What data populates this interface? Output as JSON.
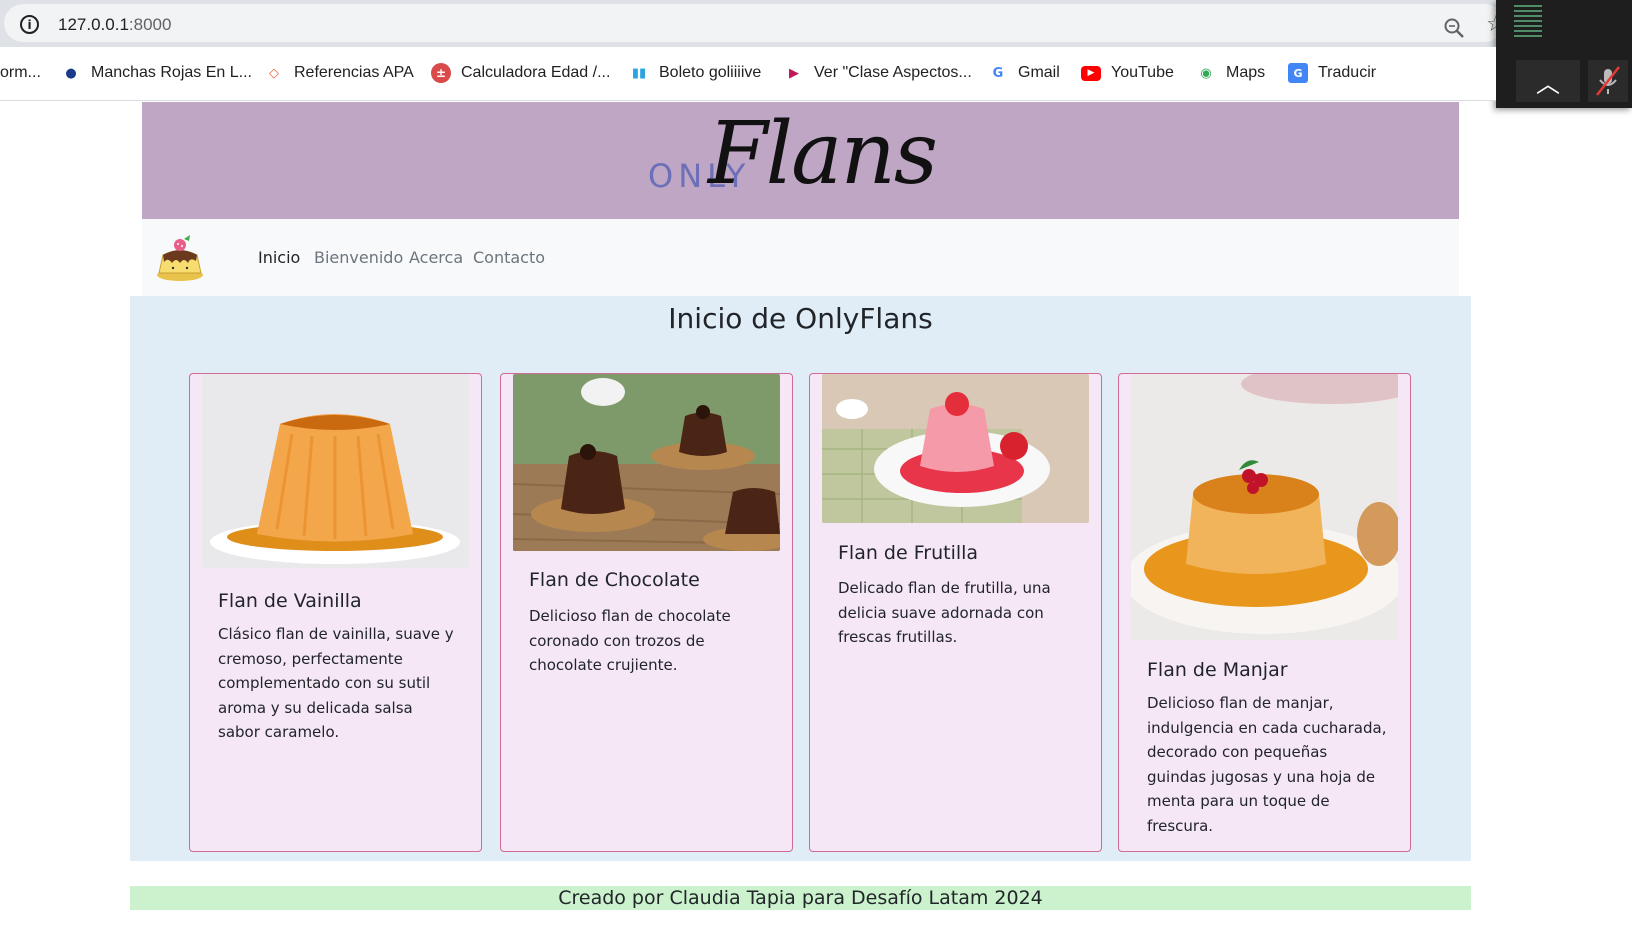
{
  "browser": {
    "url_host": "127.0.0.1",
    "url_port": ":8000",
    "bookmarks": [
      {
        "label": "orm...",
        "icon": "doc-icon"
      },
      {
        "label": "Manchas Rojas En L...",
        "icon": "apple-icon"
      },
      {
        "label": "Referencias APA",
        "icon": "grad-cap-icon"
      },
      {
        "label": "Calculadora Edad /...",
        "icon": "calc-icon"
      },
      {
        "label": "Boleto goliiiive",
        "icon": "bars-icon"
      },
      {
        "label": "Ver \"Clase Aspectos...",
        "icon": "play-icon"
      },
      {
        "label": "Gmail",
        "icon": "google-icon"
      },
      {
        "label": "YouTube",
        "icon": "youtube-icon"
      },
      {
        "label": "Maps",
        "icon": "maps-pin-icon"
      },
      {
        "label": "Traducir",
        "icon": "translate-icon"
      }
    ]
  },
  "header": {
    "logo_only": "ONLY",
    "logo_flans": "Flans"
  },
  "nav": {
    "items": [
      {
        "label": "Inicio",
        "active": true
      },
      {
        "label": "Bienvenido",
        "active": false
      },
      {
        "label": "Acerca",
        "active": false
      },
      {
        "label": "Contacto",
        "active": false
      }
    ]
  },
  "main": {
    "title": "Inicio de OnlyFlans",
    "cards": [
      {
        "title": "Flan de Vainilla",
        "text": "Clásico flan de vainilla, suave y cremoso, perfectamente complementado con su sutil aroma y su delicada salsa sabor caramelo.",
        "image": "vanilla-flan-photo"
      },
      {
        "title": "Flan de Chocolate",
        "text": "Delicioso flan de chocolate coronado con trozos de chocolate crujiente.",
        "image": "chocolate-flan-photo"
      },
      {
        "title": "Flan de Frutilla",
        "text": "Delicado flan de frutilla, una delicia suave adornada con frescas frutillas.",
        "image": "strawberry-flan-photo"
      },
      {
        "title": "Flan de Manjar",
        "text": "Delicioso flan de manjar, indulgencia en cada cucharada, decorado con pequeñas guindas jugosas y una hoja de menta para un toque de frescura.",
        "image": "manjar-flan-photo"
      }
    ]
  },
  "footer": {
    "text": "Creado por Claudia Tapia para Desafío Latam 2024"
  },
  "colors": {
    "hero_bg": "#bea6c4",
    "main_bg": "#e0ecf6",
    "card_bg": "#f5e7f5",
    "card_border": "#d16b93",
    "footer_bg": "#cbf2cd"
  }
}
